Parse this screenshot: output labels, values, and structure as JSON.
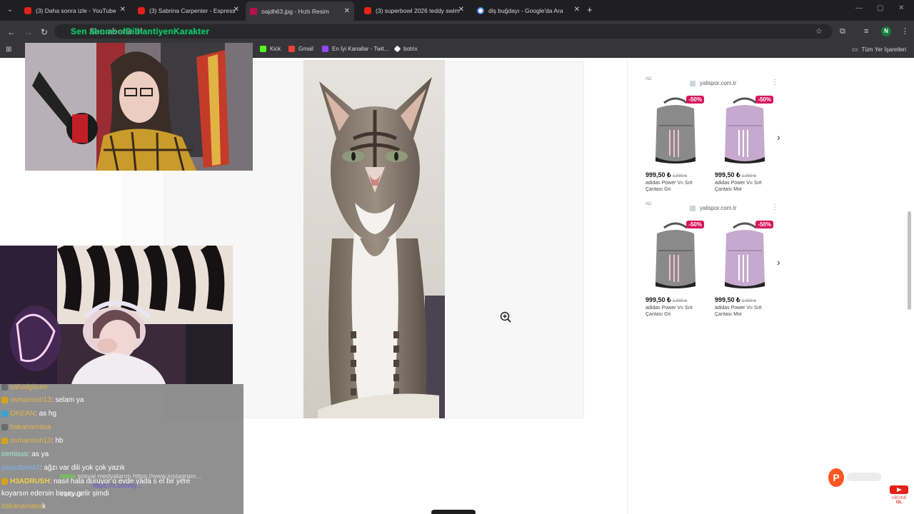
{
  "tabs": [
    {
      "title": "(3) Daha sonra izle - YouTube",
      "favicon": "youtube-icon"
    },
    {
      "title": "(3) Sabrina Carpenter - Espresso",
      "favicon": "youtube-icon"
    },
    {
      "title": "oajdh63.jpg - Hızlı Resim",
      "favicon": "image-icon",
      "active": true
    },
    {
      "title": "(3) superbowl 2026 teddy swim",
      "favicon": "youtube-icon"
    },
    {
      "title": "diş buğdayı - Google'da Ara",
      "favicon": "google-icon"
    }
  ],
  "toolbar": {
    "overlay_text_main": "Sen abone ol",
    "overlay_text_secondary": "DilhantiyenKarakter"
  },
  "bookmarks": [
    {
      "label": "Kick",
      "color": "#53fc18"
    },
    {
      "label": "Gmail",
      "color": "#ea4335"
    },
    {
      "label": "En İyi Kanallar - Twit...",
      "color": "#9146ff"
    },
    {
      "label": "botrix",
      "color": "#ffffff"
    }
  ],
  "bookmarks_all": "Tüm Yer İşaretleri",
  "ads": [
    {
      "label": "AD",
      "site": "yalispor.com.tr",
      "products": [
        {
          "discount": "-50%",
          "price": "999,50 ₺",
          "old_price": "1.999 ₺",
          "name": "adidas Power Vıı Sırt Çantası Gri",
          "color": "#8a8a8a"
        },
        {
          "discount": "-50%",
          "price": "999,50 ₺",
          "old_price": "1.999 ₺",
          "name": "adidas Power Vıı Sırt Çantası Mor",
          "color": "#c7a9cf"
        }
      ]
    },
    {
      "label": "AD",
      "site": "yalispor.com.tr",
      "products": [
        {
          "discount": "-50%",
          "price": "999,50 ₺",
          "old_price": "1.999 ₺",
          "name": "adidas Power Vıı Sırt Çantası Gri",
          "color": "#8a8a8a"
        },
        {
          "discount": "-50%",
          "price": "999,50 ₺",
          "old_price": "1.999 ₺",
          "name": "adidas Power Vıı Sırt Çantası Mor",
          "color": "#c7a9cf"
        }
      ]
    }
  ],
  "chat": [
    {
      "user": "salvalgisum",
      "text": "",
      "color": "#e0b64a",
      "badge": "#6b6b6b"
    },
    {
      "user": "osmannuri13",
      "text": ": selam ya",
      "color": "#e0b64a",
      "badge": "#d9a11a"
    },
    {
      "user": "OKEAN",
      "text": ": as hg",
      "color": "#e0b64a",
      "badge": "#33a4d8"
    },
    {
      "user": "bakanamasa",
      "text": "",
      "color": "#e0b64a",
      "badge": "#6b6b6b"
    },
    {
      "user": "osmannuri13",
      "text": ": hb",
      "color": "#e0b64a",
      "badge": "#d9a11a"
    },
    {
      "user": "iremisss",
      "text": ": as ya",
      "color": "#9ef0d0",
      "badge": "#6b6b6b"
    },
    {
      "user": "yavuzbeo41",
      "text": ": ağzı var dili yok çok yazık",
      "color": "#7fb0ff",
      "badge": "#6b6b6b"
    },
    {
      "user": "H3ADRUSH",
      "text": ": nasıl hala duruyor o evde yada s el bir yere",
      "color": "#f2ce4a",
      "badge": "#d9a11a"
    },
    {
      "user": "",
      "text": "koyarsın edersin birşey gelir şimdi",
      "color": "#ffffff",
      "badge": ""
    },
    {
      "user": "bakanamasa",
      "text": "k",
      "color": "#e0b64a",
      "badge": "#6b6b6b"
    }
  ],
  "bot_message": {
    "name": "botrix",
    "text": "sosyal medyalarım https://www.instagram...",
    "link": "https://x.com/lly...",
    "extra": "ewlendi"
  },
  "status": {
    "patreon_letter": "P",
    "abone_label": "ABONE OL"
  }
}
